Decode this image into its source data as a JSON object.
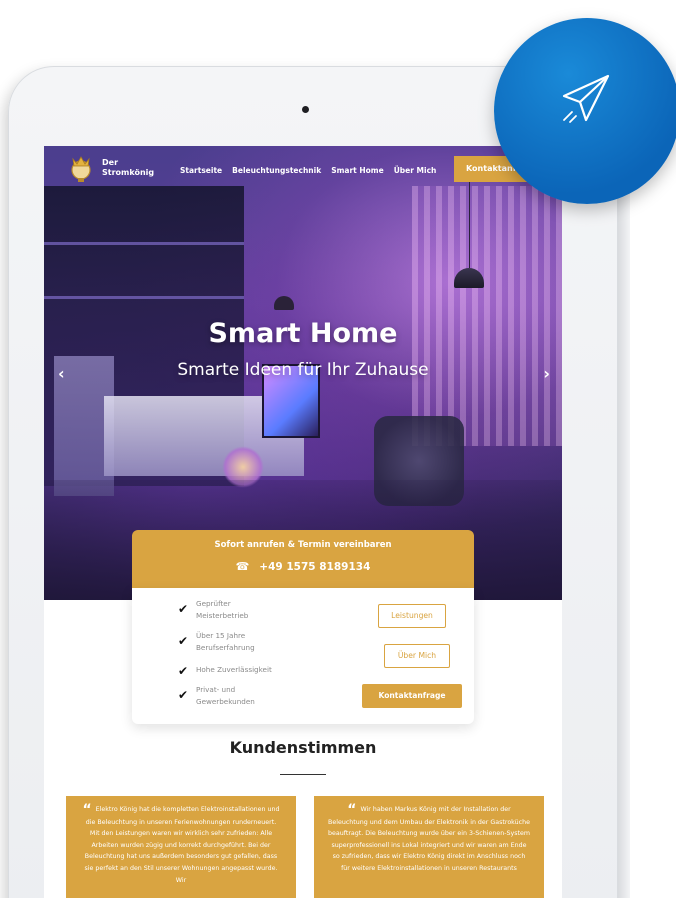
{
  "header": {
    "logo_line1": "Der",
    "logo_line2": "Stromkönig",
    "nav": [
      "Startseite",
      "Beleuchtungstechnik",
      "Smart Home",
      "Über Mich"
    ],
    "cta_label": "Kontaktanfr..."
  },
  "hero": {
    "title": "Smart Home",
    "subtitle": "Smarte Ideen für Ihr Zuhause",
    "prev_arrow": "‹",
    "next_arrow": "›"
  },
  "call_box": {
    "title": "Sofort anrufen & Termin vereinbaren",
    "phone_icon": "☎",
    "phone": "+49 1575 8189134"
  },
  "features": [
    {
      "icon": "✔",
      "line1": "Geprüfter",
      "line2": "Meisterbetrieb"
    },
    {
      "icon": "✔",
      "line1": "Über 15 Jahre",
      "line2": "Berufserfahrung"
    },
    {
      "icon": "✔",
      "line1": "Hohe Zuverlässigkeit",
      "line2": ""
    },
    {
      "icon": "✔",
      "line1": "Privat- und",
      "line2": "Gewerbekunden"
    }
  ],
  "feature_buttons": {
    "services": "Leistungen",
    "about": "Über Mich",
    "contact": "Kontaktanfrage"
  },
  "testimonials": {
    "title": "Kundenstimmen",
    "items": [
      {
        "quote_mark": "“",
        "text": "Elektro König hat die kompletten Elektroinstallationen und die Beleuchtung in unseren Ferienwohnungen runderneuert. Mit den Leistungen waren wir wirklich sehr zufrieden: Alle Arbeiten wurden zügig und korrekt durchgeführt. Bei der Beleuchtung hat uns außerdem besonders gut gefallen, dass sie perfekt an den Stil unserer Wohnungen angepasst wurde. Wir"
      },
      {
        "quote_mark": "“",
        "text": "Wir haben Markus König mit der Installation der Beleuchtung und dem Umbau der Elektronik in der Gastroküche beauftragt. Die Beleuchtung wurde über ein 3-Schienen-System superprofessionell ins Lokal integriert und wir waren am Ende so zufrieden, dass wir Elektro König direkt im Anschluss noch für weitere Elektroinstallationen in unseren Restaurants"
      }
    ]
  },
  "colors": {
    "accent": "#d9a441",
    "fab": "#0b65b8"
  },
  "icons": {
    "fab": "paper-plane-icon",
    "logo": "crown-bulb-icon",
    "check": "checkmark-icon",
    "phone": "phone-icon"
  }
}
